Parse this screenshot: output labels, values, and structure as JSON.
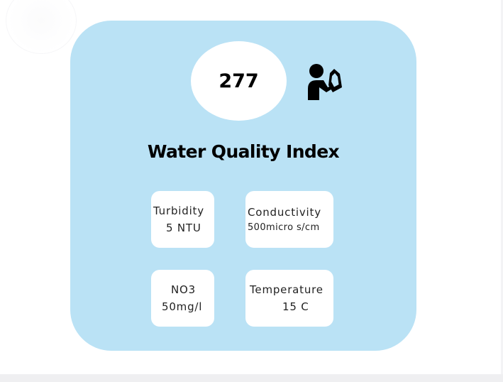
{
  "wqi": {
    "score": "277",
    "title": "Water Quality Index",
    "icon": "person-drinking-icon"
  },
  "metrics": {
    "turbidity": {
      "label": "Turbidity",
      "value": "5 NTU"
    },
    "conductivity": {
      "label": "Conductivity",
      "value": "500micro s/cm"
    },
    "no3": {
      "label": "NO3",
      "value": "50mg/l"
    },
    "temperature": {
      "label": "Temperature",
      "value": "15 C"
    }
  },
  "colors": {
    "card_background": "#bae2f5",
    "tile_background": "#ffffff",
    "text": "#000000"
  }
}
